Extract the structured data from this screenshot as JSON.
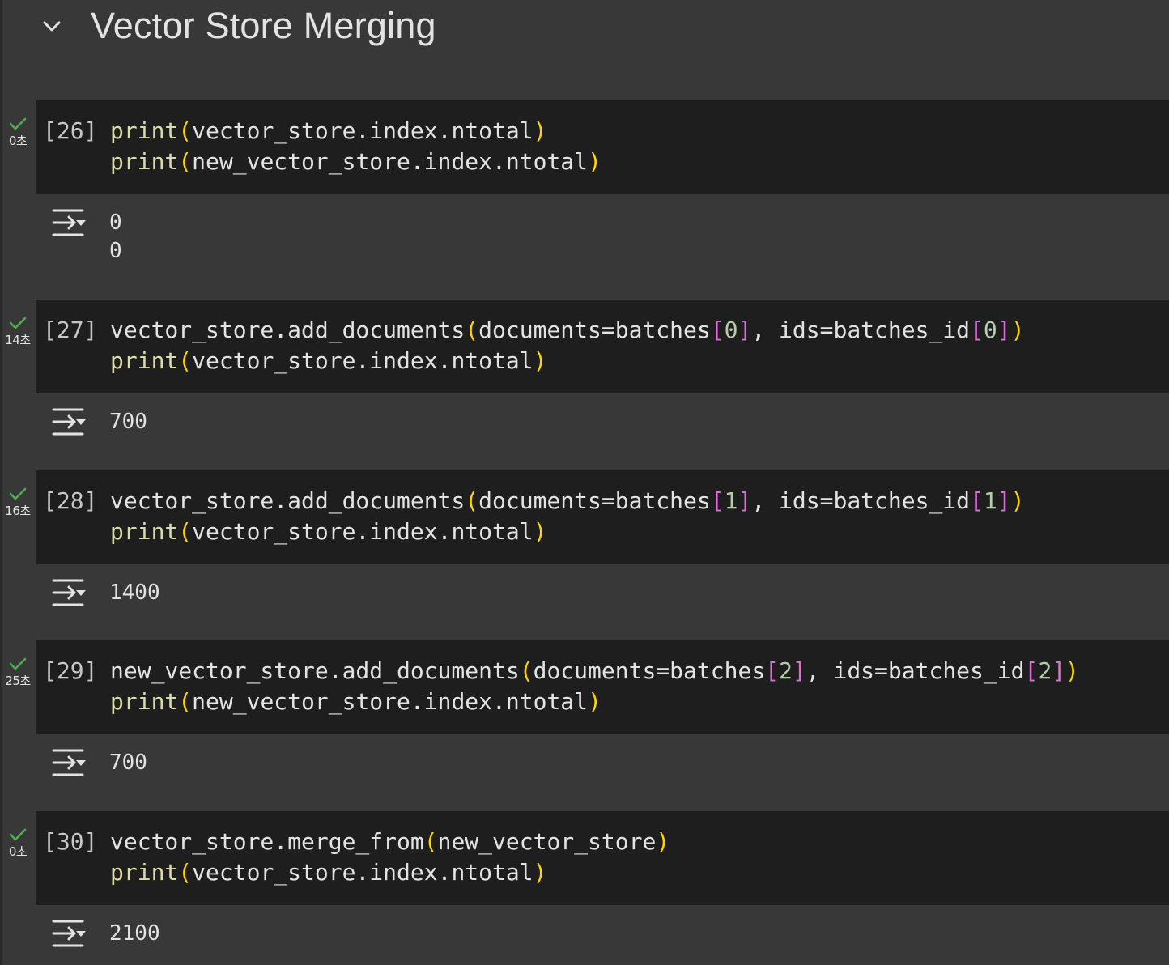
{
  "section": {
    "title": "Vector Store Merging"
  },
  "cells": [
    {
      "exec_count": "[26]",
      "exec_time": "0초",
      "line1": [
        {
          "t": "print",
          "c": "fn"
        },
        {
          "t": "(",
          "c": "pr"
        },
        {
          "t": "vector_store.index.ntotal",
          "c": ""
        },
        {
          "t": ")",
          "c": "pr"
        }
      ],
      "line2": [
        {
          "t": "print",
          "c": "fn"
        },
        {
          "t": "(",
          "c": "pr"
        },
        {
          "t": "new_vector_store.index.ntotal",
          "c": ""
        },
        {
          "t": ")",
          "c": "pr"
        }
      ],
      "output": "0\n0"
    },
    {
      "exec_count": "[27]",
      "exec_time": "14초",
      "line1": [
        {
          "t": "vector_store.add_documents",
          "c": ""
        },
        {
          "t": "(",
          "c": "pr"
        },
        {
          "t": "documents=batches",
          "c": ""
        },
        {
          "t": "[",
          "c": "br"
        },
        {
          "t": "0",
          "c": "num"
        },
        {
          "t": "]",
          "c": "br"
        },
        {
          "t": ", ids=batches_id",
          "c": ""
        },
        {
          "t": "[",
          "c": "br"
        },
        {
          "t": "0",
          "c": "num"
        },
        {
          "t": "]",
          "c": "br"
        },
        {
          "t": ")",
          "c": "pr"
        }
      ],
      "line2": [
        {
          "t": "print",
          "c": "fn"
        },
        {
          "t": "(",
          "c": "pr"
        },
        {
          "t": "vector_store.index.ntotal",
          "c": ""
        },
        {
          "t": ")",
          "c": "pr"
        }
      ],
      "output": "700"
    },
    {
      "exec_count": "[28]",
      "exec_time": "16초",
      "line1": [
        {
          "t": "vector_store.add_documents",
          "c": ""
        },
        {
          "t": "(",
          "c": "pr"
        },
        {
          "t": "documents=batches",
          "c": ""
        },
        {
          "t": "[",
          "c": "br"
        },
        {
          "t": "1",
          "c": "num"
        },
        {
          "t": "]",
          "c": "br"
        },
        {
          "t": ", ids=batches_id",
          "c": ""
        },
        {
          "t": "[",
          "c": "br"
        },
        {
          "t": "1",
          "c": "num"
        },
        {
          "t": "]",
          "c": "br"
        },
        {
          "t": ")",
          "c": "pr"
        }
      ],
      "line2": [
        {
          "t": "print",
          "c": "fn"
        },
        {
          "t": "(",
          "c": "pr"
        },
        {
          "t": "vector_store.index.ntotal",
          "c": ""
        },
        {
          "t": ")",
          "c": "pr"
        }
      ],
      "output": "1400"
    },
    {
      "exec_count": "[29]",
      "exec_time": "25초",
      "line1": [
        {
          "t": "new_vector_store.add_documents",
          "c": ""
        },
        {
          "t": "(",
          "c": "pr"
        },
        {
          "t": "documents=batches",
          "c": ""
        },
        {
          "t": "[",
          "c": "br"
        },
        {
          "t": "2",
          "c": "num"
        },
        {
          "t": "]",
          "c": "br"
        },
        {
          "t": ", ids=batches_id",
          "c": ""
        },
        {
          "t": "[",
          "c": "br"
        },
        {
          "t": "2",
          "c": "num"
        },
        {
          "t": "]",
          "c": "br"
        },
        {
          "t": ")",
          "c": "pr"
        }
      ],
      "line2": [
        {
          "t": "print",
          "c": "fn"
        },
        {
          "t": "(",
          "c": "pr"
        },
        {
          "t": "new_vector_store.index.ntotal",
          "c": ""
        },
        {
          "t": ")",
          "c": "pr"
        }
      ],
      "output": "700"
    },
    {
      "exec_count": "[30]",
      "exec_time": "0초",
      "line1": [
        {
          "t": "vector_store.merge_from",
          "c": ""
        },
        {
          "t": "(",
          "c": "pr"
        },
        {
          "t": "new_vector_store",
          "c": ""
        },
        {
          "t": ")",
          "c": "pr"
        }
      ],
      "line2": [
        {
          "t": "print",
          "c": "fn"
        },
        {
          "t": "(",
          "c": "pr"
        },
        {
          "t": "vector_store.index.ntotal",
          "c": ""
        },
        {
          "t": ")",
          "c": "pr"
        }
      ],
      "output": "2100"
    }
  ],
  "colors": {
    "background": "#383838",
    "code_background": "#1e1e1e",
    "check": "#4caf50",
    "function": "#dcdcaa",
    "paren": "#ffd500",
    "bracket": "#da70d6",
    "number": "#b5cea8"
  },
  "icons": {
    "section_toggle": "chevron-down-icon",
    "status": "check-icon",
    "output_toggle": "output-toggle-icon"
  }
}
